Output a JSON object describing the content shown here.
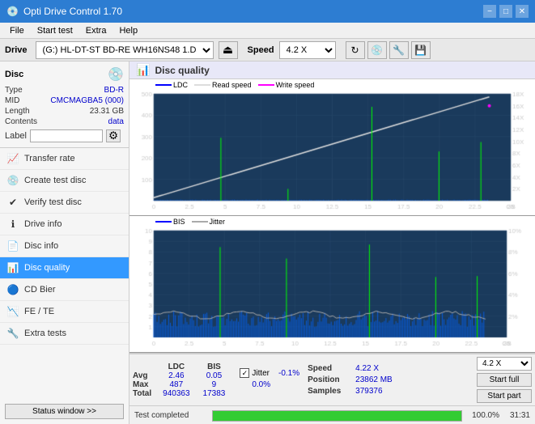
{
  "titlebar": {
    "title": "Opti Drive Control 1.70",
    "icon": "💿",
    "minimize": "−",
    "maximize": "□",
    "close": "✕"
  },
  "menubar": {
    "items": [
      "File",
      "Start test",
      "Extra",
      "Help"
    ]
  },
  "drivebar": {
    "label": "Drive",
    "drive_value": "(G:) HL-DT-ST BD-RE  WH16NS48 1.D3",
    "speed_label": "Speed",
    "speed_value": "4.2 X"
  },
  "disc": {
    "title": "Disc",
    "type_label": "Type",
    "type_value": "BD-R",
    "mid_label": "MID",
    "mid_value": "CMCMAGBA5 (000)",
    "length_label": "Length",
    "length_value": "23.31 GB",
    "contents_label": "Contents",
    "contents_value": "data",
    "label_label": "Label",
    "label_value": ""
  },
  "nav": {
    "items": [
      {
        "id": "transfer-rate",
        "label": "Transfer rate",
        "icon": "📈"
      },
      {
        "id": "create-test-disc",
        "label": "Create test disc",
        "icon": "💿"
      },
      {
        "id": "verify-test-disc",
        "label": "Verify test disc",
        "icon": "✔"
      },
      {
        "id": "drive-info",
        "label": "Drive info",
        "icon": "ℹ"
      },
      {
        "id": "disc-info",
        "label": "Disc info",
        "icon": "📄"
      },
      {
        "id": "disc-quality",
        "label": "Disc quality",
        "icon": "📊",
        "active": true
      },
      {
        "id": "cd-bier",
        "label": "CD Bier",
        "icon": "🔵"
      },
      {
        "id": "fe-te",
        "label": "FE / TE",
        "icon": "📉"
      },
      {
        "id": "extra-tests",
        "label": "Extra tests",
        "icon": "🔧"
      }
    ],
    "status_btn": "Status window >>"
  },
  "disc_quality": {
    "title": "Disc quality",
    "legend": {
      "ldc_label": "LDC",
      "ldc_color": "#0000ff",
      "read_label": "Read speed",
      "read_color": "#ffffff",
      "write_label": "Write speed",
      "write_color": "#ff00ff"
    },
    "legend2": {
      "bis_label": "BIS",
      "bis_color": "#0000ff",
      "jitter_label": "Jitter",
      "jitter_color": "#ffffff"
    },
    "chart1": {
      "y_max": 500,
      "x_max": 25,
      "x_label": "GB"
    },
    "chart2": {
      "y_max": 10,
      "x_max": 25,
      "x_label": "GB"
    },
    "stats": {
      "headers": [
        "LDC",
        "BIS",
        "",
        "Jitter",
        "Speed",
        ""
      ],
      "avg_label": "Avg",
      "avg_ldc": "2.46",
      "avg_bis": "0.05",
      "avg_jitter": "-0.1%",
      "max_label": "Max",
      "max_ldc": "487",
      "max_bis": "9",
      "max_jitter": "0.0%",
      "total_label": "Total",
      "total_ldc": "940363",
      "total_bis": "17383",
      "speed_label": "Speed",
      "speed_value": "4.22 X",
      "position_label": "Position",
      "position_value": "23862 MB",
      "samples_label": "Samples",
      "samples_value": "379376",
      "jitter_checked": true,
      "speed_dropdown": "4.2 X"
    },
    "buttons": {
      "start_full": "Start full",
      "start_part": "Start part"
    }
  },
  "statusbar": {
    "status_text": "Test completed",
    "progress": 100,
    "progress_text": "100.0%",
    "time": "31:31"
  }
}
